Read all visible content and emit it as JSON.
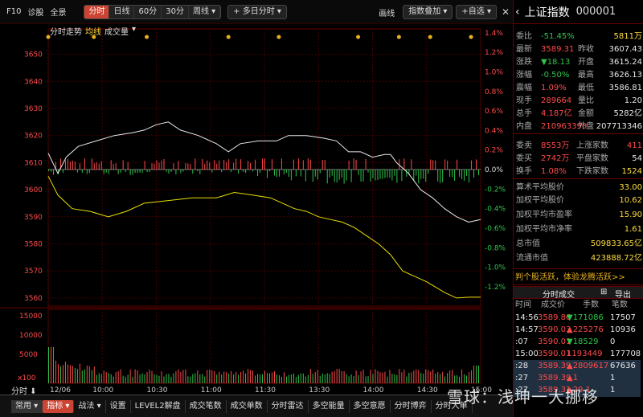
{
  "toolbar": {
    "f10": "F10",
    "diagnose": "诊股",
    "fullscreen": "全景",
    "periods": [
      "分时",
      "日线",
      "60分",
      "30分",
      "周线 ▾"
    ],
    "multiday": "+ 多日分时 ▾",
    "draw": "画线",
    "indicator": "指数叠加 ▾",
    "fav": "+自选 ▾",
    "close": "✕"
  },
  "chart": {
    "legend": [
      "分时走势",
      "均线",
      "成交量",
      "▾"
    ],
    "y_left": [
      "3650",
      "3640",
      "3630",
      "3620",
      "3610",
      "3600",
      "3590",
      "3580",
      "3570",
      "3560"
    ],
    "y_right": [
      "1.4%",
      "1.2%",
      "1.0%",
      "0.8%",
      "0.6%",
      "0.4%",
      "0.2%",
      "0.0%",
      "-0.2%",
      "-0.4%",
      "-0.6%",
      "-0.8%",
      "-1.0%",
      "-1.2%"
    ],
    "vol_left": [
      "15000",
      "10000",
      "5000"
    ],
    "vol_unit": "x100",
    "x_ticks": [
      "12/06",
      "10:00",
      "10:30",
      "11:00",
      "11:30",
      "13:30",
      "14:00",
      "14:30",
      "15:00"
    ],
    "bottom_left": "分时 ⬇"
  },
  "colors": {
    "price": "#e8e8e8",
    "avg": "#e8e000",
    "up": "#ff4a4a",
    "down": "#2ec44a",
    "grid": "#600"
  },
  "chart_data": {
    "type": "line",
    "series": [
      {
        "name": "分时走势",
        "points": [
          [
            0,
            3613.5
          ],
          [
            8,
            3606
          ],
          [
            15,
            3612
          ],
          [
            25,
            3616
          ],
          [
            40,
            3618
          ],
          [
            55,
            3620
          ],
          [
            70,
            3621
          ],
          [
            80,
            3622
          ],
          [
            90,
            3624
          ],
          [
            100,
            3625
          ],
          [
            110,
            3622
          ],
          [
            125,
            3620
          ],
          [
            140,
            3617
          ],
          [
            150,
            3614
          ],
          [
            160,
            3617
          ],
          [
            175,
            3618
          ],
          [
            190,
            3618
          ],
          [
            200,
            3620
          ],
          [
            215,
            3620
          ],
          [
            230,
            3619
          ],
          [
            240,
            3618
          ],
          [
            250,
            3614
          ],
          [
            260,
            3614
          ],
          [
            270,
            3612
          ],
          [
            280,
            3613
          ],
          [
            285,
            3613
          ],
          [
            290,
            3610
          ],
          [
            300,
            3606
          ],
          [
            310,
            3600
          ],
          [
            320,
            3597
          ],
          [
            330,
            3593
          ],
          [
            340,
            3590
          ],
          [
            350,
            3588
          ],
          [
            360,
            3589
          ]
        ]
      },
      {
        "name": "均线",
        "points": [
          [
            0,
            3605
          ],
          [
            8,
            3598
          ],
          [
            20,
            3593
          ],
          [
            35,
            3592
          ],
          [
            50,
            3590
          ],
          [
            65,
            3592
          ],
          [
            80,
            3595
          ],
          [
            100,
            3596
          ],
          [
            120,
            3597
          ],
          [
            140,
            3597
          ],
          [
            155,
            3599
          ],
          [
            170,
            3598
          ],
          [
            185,
            3597
          ],
          [
            195,
            3595
          ],
          [
            205,
            3593
          ],
          [
            215,
            3592
          ],
          [
            225,
            3590
          ],
          [
            235,
            3589
          ],
          [
            245,
            3588
          ],
          [
            255,
            3586
          ],
          [
            265,
            3583
          ],
          [
            275,
            3580
          ],
          [
            285,
            3576
          ],
          [
            295,
            3570
          ],
          [
            305,
            3568
          ],
          [
            315,
            3566
          ],
          [
            330,
            3562
          ],
          [
            340,
            3560
          ],
          [
            350,
            3560.3
          ],
          [
            360,
            3560.3
          ]
        ]
      }
    ],
    "prev_close": 3607.43,
    "ylim": [
      3557,
      3657
    ]
  },
  "quote": {
    "name": "上证指数",
    "code": "000001",
    "rows": [
      {
        "l": "委比",
        "v": "-51.45%",
        "r": "5811万"
      },
      {
        "l": "最新",
        "v": "3589.31",
        "rl": "昨收",
        "r": "3607.43"
      },
      {
        "l": "涨跌",
        "v": "▼18.13",
        "rl": "开盘",
        "r": "3615.24"
      },
      {
        "l": "涨幅",
        "v": "-0.50%",
        "rl": "最高",
        "r": "3626.13"
      },
      {
        "l": "震幅",
        "v": "1.09%",
        "rl": "最低",
        "r": "3586.81"
      },
      {
        "l": "现手",
        "v": "289664",
        "rl": "量比",
        "r": "1.20"
      },
      {
        "l": "总手",
        "v": "4.187亿",
        "rl": "金额",
        "r": "5282亿"
      },
      {
        "l": "内盘",
        "v": "210963390",
        "rl": "外盘",
        "r": "207713346"
      },
      {
        "l": "委卖",
        "v": "8553万",
        "rl": "上涨家数",
        "r": "411"
      },
      {
        "l": "委买",
        "v": "2742万",
        "rl": "平盘家数",
        "r": "54"
      },
      {
        "l": "换手",
        "v": "1.08%",
        "rl": "下跌家数",
        "r": "1524"
      },
      {
        "l": "算术平均股价",
        "r": "33.00"
      },
      {
        "l": "加权平均股价",
        "r": "10.62"
      },
      {
        "l": "加权平均市盈率",
        "r": "15.90"
      },
      {
        "l": "加权平均市净率",
        "r": "1.61"
      },
      {
        "l": "总市值",
        "r": "509833.65亿"
      },
      {
        "l": "流通市值",
        "r": "423888.72亿"
      }
    ],
    "promo": "判个股活跃，体验龙腾活跃>>",
    "trade_tab": "分时成交",
    "trade_btns": [
      "⊞",
      "导出"
    ],
    "trade_hdr": [
      "时间",
      "成交价",
      "手数",
      "笔数"
    ],
    "trades": [
      {
        "t": "14:56",
        "p": "3589.86",
        "v": "▼171086",
        "n": "17507"
      },
      {
        "t": "14:57",
        "p": "3590.03",
        "v": "▲225276",
        "n": "10936"
      },
      {
        "t": ":07",
        "p": "3590.01",
        "v": "▼18529",
        "n": "0"
      },
      {
        "t": "15:00",
        "p": "3590.01",
        "v": "1193449",
        "n": "177708"
      },
      {
        "t": ":28",
        "p": "3589.39",
        "v": "▲2809617",
        "n": "67636"
      },
      {
        "t": ":27",
        "p": "3589.39",
        "v": "▲1",
        "n": "1"
      },
      {
        "t": ":27",
        "p": "3589.31",
        "v": "▲29 1",
        "n": "1"
      }
    ]
  },
  "bottombar": [
    "常用 ▾",
    "指标 ▾",
    "战法 ▾",
    "设置",
    "LEVEL2解盘",
    "成交笔数",
    "成交单数",
    "分时雷达",
    "多空能量",
    "多空意愿",
    "分时博弈",
    "分时大单"
  ],
  "watermark": "雪球：浅坤一大挪移"
}
